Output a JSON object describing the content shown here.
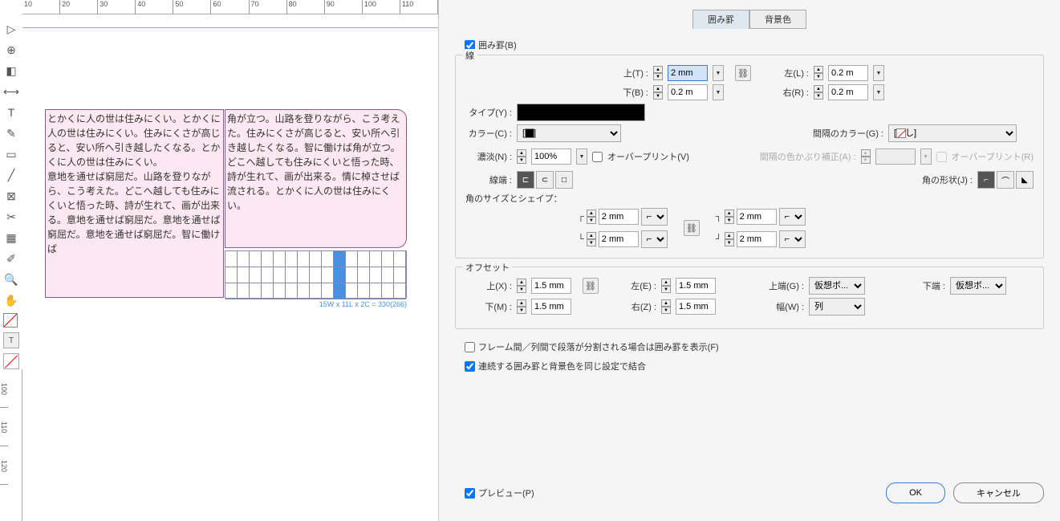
{
  "ruler_h": [
    "10",
    "20",
    "30",
    "40",
    "50",
    "60",
    "70",
    "80",
    "90",
    "100",
    "110"
  ],
  "ruler_v": [
    "100",
    "110",
    "120"
  ],
  "text_col1": "とかくに人の世は住みにくい。とかくに人の世は住みにくい。住みにくさが高じると、安い所へ引き越したくなる。とかくに人の世は住みにくい。\n意地を通せば窮屈だ。山路を登りながら、こう考えた。どこへ越しても住みにくいと悟った時、詩が生れて、画が出来る。意地を通せば窮屈だ。意地を通せば窮屈だ。意地を通せば窮屈だ。智に働けば",
  "text_col2": "角が立つ。山路を登りながら、こう考えた。住みにくさが高じると、安い所へ引き越したくなる。智に働けば角が立つ。どこへ越しても住みにくいと悟った時、詩が生れて、画が出来る。情に棹させば流される。とかくに人の世は住みにくい。",
  "stats": "15W x 11L x 2C = 330(266)",
  "tabs": {
    "kei": "囲み罫",
    "bg": "背景色"
  },
  "kakomi_label": "囲み罫(B)",
  "sen_label": "線",
  "labels": {
    "top": "上(T)",
    "bottom": "下(B)",
    "left": "左(L)",
    "right": "右(R)",
    "type": "タイプ(Y)",
    "color": "カラー(C)",
    "noudo": "濃淡(N)",
    "overprint": "オーバープリント(V)",
    "gap_color": "間隔のカラー(G)",
    "gap_noudo": "間隔の色かぶり補正(A)",
    "overprint_r": "オーバープリント(R)",
    "lineend": "線端",
    "corner_shape": "角の形状(J)",
    "corner_size": "角のサイズとシェイプ：",
    "offset": "オフセット",
    "off_x": "上(X)",
    "off_m": "下(M)",
    "off_e": "左(E)",
    "off_z": "右(Z)",
    "off_g": "上端(G)",
    "off_bottom": "下端",
    "off_w": "幅(W)",
    "frame_split": "フレーム間／列間で段落が分割される場合は囲み罫を表示(F)",
    "continuous": "連続する囲み罫と背景色を同じ設定で結合",
    "preview": "プレビュー(P)"
  },
  "values": {
    "top": "2 mm",
    "bottom": "0.2 m",
    "left": "0.2 m",
    "right": "0.2 m",
    "color_black": "[黒]",
    "color_none": "[なし]",
    "noudo": "100%",
    "corner": "2 mm",
    "off_x": "1.5 mm",
    "off_m": "1.5 mm",
    "off_e": "1.5 mm",
    "off_z": "1.5 mm",
    "virtual_body": "仮想ボ...",
    "col": "列"
  },
  "buttons": {
    "ok": "OK",
    "cancel": "キャンセル"
  }
}
